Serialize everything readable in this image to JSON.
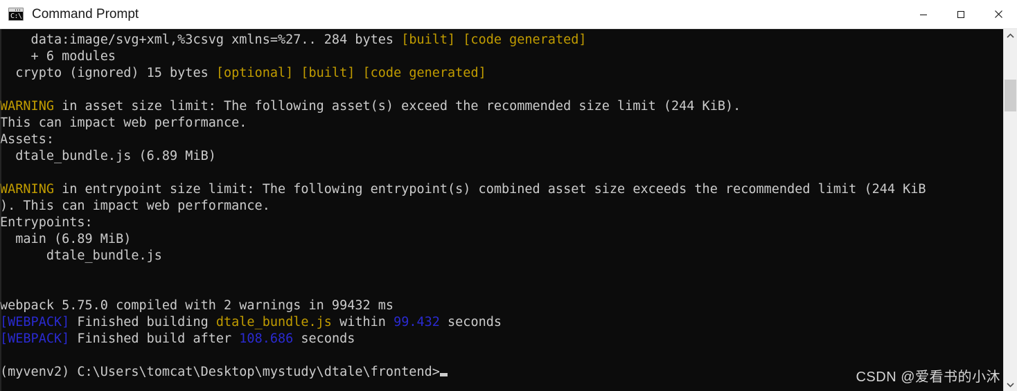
{
  "window": {
    "title": "Command Prompt",
    "icon": "command-prompt-icon",
    "icon_glyph": "C:\\.",
    "controls": {
      "minimize": "—",
      "maximize": "□",
      "close": "✕"
    }
  },
  "colors": {
    "background": "#0c0c0c",
    "foreground": "#cccccc",
    "yellow": "#c19c00",
    "blue": "#2a2ad0",
    "titlebar_bg": "#ffffff",
    "titlebar_fg": "#1a1a1a",
    "scrollbar_track": "#f0f0f0",
    "scrollbar_thumb": "#cdcdcd",
    "watermark": "#d6d6d6"
  },
  "terminal": {
    "lines": [
      {
        "id": "line-asset-svg",
        "segments": [
          {
            "text": "    data:image/svg+xml,%3csvg xmlns=%27.. 284 bytes ",
            "color": "white"
          },
          {
            "text": "[built]",
            "color": "yellow"
          },
          {
            "text": " ",
            "color": "white"
          },
          {
            "text": "[code generated]",
            "color": "yellow"
          }
        ]
      },
      {
        "id": "line-plus-modules",
        "segments": [
          {
            "text": "    + 6 modules",
            "color": "white"
          }
        ]
      },
      {
        "id": "line-crypto",
        "segments": [
          {
            "text": "  crypto (ignored) 15 bytes ",
            "color": "white"
          },
          {
            "text": "[optional]",
            "color": "yellow"
          },
          {
            "text": " ",
            "color": "white"
          },
          {
            "text": "[built]",
            "color": "yellow"
          },
          {
            "text": " ",
            "color": "white"
          },
          {
            "text": "[code generated]",
            "color": "yellow"
          }
        ]
      },
      {
        "id": "line-blank-1",
        "segments": [
          {
            "text": "",
            "color": "white"
          }
        ]
      },
      {
        "id": "line-warning-asset",
        "segments": [
          {
            "text": "WARNING",
            "color": "yellow"
          },
          {
            "text": " in asset size limit: The following asset(s) exceed the recommended size limit (244 KiB).",
            "color": "white"
          }
        ]
      },
      {
        "id": "line-warning-asset-cont",
        "segments": [
          {
            "text": "This can impact web performance.",
            "color": "white"
          }
        ]
      },
      {
        "id": "line-assets-header",
        "segments": [
          {
            "text": "Assets:",
            "color": "white"
          }
        ]
      },
      {
        "id": "line-asset-bundle",
        "segments": [
          {
            "text": "  dtale_bundle.js (6.89 MiB)",
            "color": "white"
          }
        ]
      },
      {
        "id": "line-blank-2",
        "segments": [
          {
            "text": "",
            "color": "white"
          }
        ]
      },
      {
        "id": "line-warning-entrypoint",
        "segments": [
          {
            "text": "WARNING",
            "color": "yellow"
          },
          {
            "text": " in entrypoint size limit: The following entrypoint(s) combined asset size exceeds the recommended limit (244 KiB",
            "color": "white"
          }
        ]
      },
      {
        "id": "line-warning-entrypoint-cont",
        "segments": [
          {
            "text": "). This can impact web performance.",
            "color": "white"
          }
        ]
      },
      {
        "id": "line-entrypoints-header",
        "segments": [
          {
            "text": "Entrypoints:",
            "color": "white"
          }
        ]
      },
      {
        "id": "line-entrypoint-main",
        "segments": [
          {
            "text": "  main (6.89 MiB)",
            "color": "white"
          }
        ]
      },
      {
        "id": "line-entrypoint-bundle",
        "segments": [
          {
            "text": "      dtale_bundle.js",
            "color": "white"
          }
        ]
      },
      {
        "id": "line-blank-3",
        "segments": [
          {
            "text": "",
            "color": "white"
          }
        ]
      },
      {
        "id": "line-blank-4",
        "segments": [
          {
            "text": "",
            "color": "white"
          }
        ]
      },
      {
        "id": "line-webpack-compiled",
        "segments": [
          {
            "text": "webpack 5.75.0 compiled with 2 warnings in 99432 ms",
            "color": "white"
          }
        ]
      },
      {
        "id": "line-webpack-finished-building",
        "segments": [
          {
            "text": "[WEBPACK]",
            "color": "blue"
          },
          {
            "text": " Finished building ",
            "color": "white"
          },
          {
            "text": "dtale_bundle.js",
            "color": "gold"
          },
          {
            "text": " within ",
            "color": "white"
          },
          {
            "text": "99.432",
            "color": "blue"
          },
          {
            "text": " seconds",
            "color": "white"
          }
        ]
      },
      {
        "id": "line-webpack-finished-build",
        "segments": [
          {
            "text": "[WEBPACK]",
            "color": "blue"
          },
          {
            "text": " Finished build after ",
            "color": "white"
          },
          {
            "text": "108.686",
            "color": "blue"
          },
          {
            "text": " seconds",
            "color": "white"
          }
        ]
      },
      {
        "id": "line-blank-5",
        "segments": [
          {
            "text": "",
            "color": "white"
          }
        ]
      },
      {
        "id": "line-prompt",
        "prompt": true,
        "segments": [
          {
            "text": "(myvenv2) C:\\Users\\tomcat\\Desktop\\mystudy\\dtale\\frontend>",
            "color": "white"
          }
        ]
      }
    ]
  },
  "scrollbar": {
    "up_arrow": "scroll-up-arrow",
    "down_arrow": "scroll-down-arrow",
    "thumb": "scroll-thumb"
  },
  "watermark": {
    "text": "CSDN @爱看书的小沐"
  }
}
